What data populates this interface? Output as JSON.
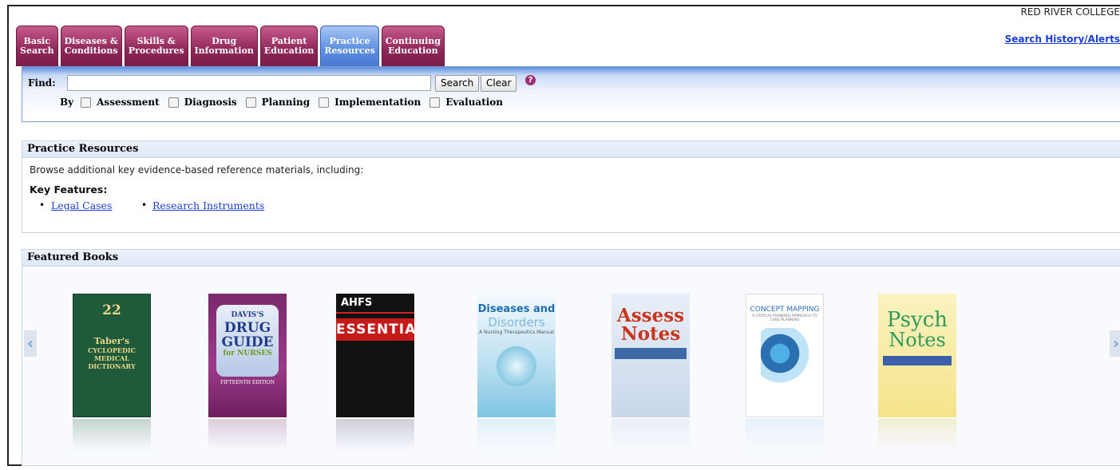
{
  "header": {
    "institution": "RED RIVER COLLEGE",
    "history_link": "Search History/Alerts"
  },
  "tabs": [
    {
      "line1": "Basic",
      "line2": "Search",
      "active": false
    },
    {
      "line1": "Diseases &",
      "line2": "Conditions",
      "active": false
    },
    {
      "line1": "Skills &",
      "line2": "Procedures",
      "active": false
    },
    {
      "line1": "Drug",
      "line2": "Information",
      "active": false
    },
    {
      "line1": "Patient",
      "line2": "Education",
      "active": false
    },
    {
      "line1": "Practice",
      "line2": "Resources",
      "active": true
    },
    {
      "line1": "Continuing",
      "line2": "Education",
      "active": false
    }
  ],
  "find": {
    "label": "Find:",
    "value": "",
    "search_button": "Search",
    "clear_button": "Clear",
    "help": "?",
    "by_label": "By",
    "filters": [
      "Assessment",
      "Diagnosis",
      "Planning",
      "Implementation",
      "Evaluation"
    ]
  },
  "practice_resources": {
    "title": "Practice Resources",
    "intro": "Browse additional key evidence-based reference materials, including:",
    "key_features_label": "Key Features:",
    "links": [
      "Legal Cases",
      "Research Instruments"
    ]
  },
  "featured_books": {
    "title": "Featured Books",
    "prev_arrow": "‹",
    "next_arrow": "›",
    "covers": [
      {
        "edition": "22",
        "lines": [
          "Taber's",
          "CYCLOPEDIC",
          "MEDICAL",
          "DICTIONARY"
        ]
      },
      {
        "top": "DAVIS'S",
        "mid": "DRUG GUIDE",
        "sub": "for NURSES",
        "ed": "FIFTEENTH EDITION"
      },
      {
        "top": "AHFS",
        "mid": "ESSENTIALS"
      },
      {
        "top": "Diseases and",
        "mid": "Disorders",
        "sub": "A Nursing Therapeutics Manual"
      },
      {
        "top": "Assess",
        "mid": "Notes"
      },
      {
        "top": "CONCEPT MAPPING",
        "sub": "A CRITICAL-THINKING APPROACH TO CARE PLANNING"
      },
      {
        "top": "Psych",
        "mid": "Notes"
      }
    ]
  }
}
